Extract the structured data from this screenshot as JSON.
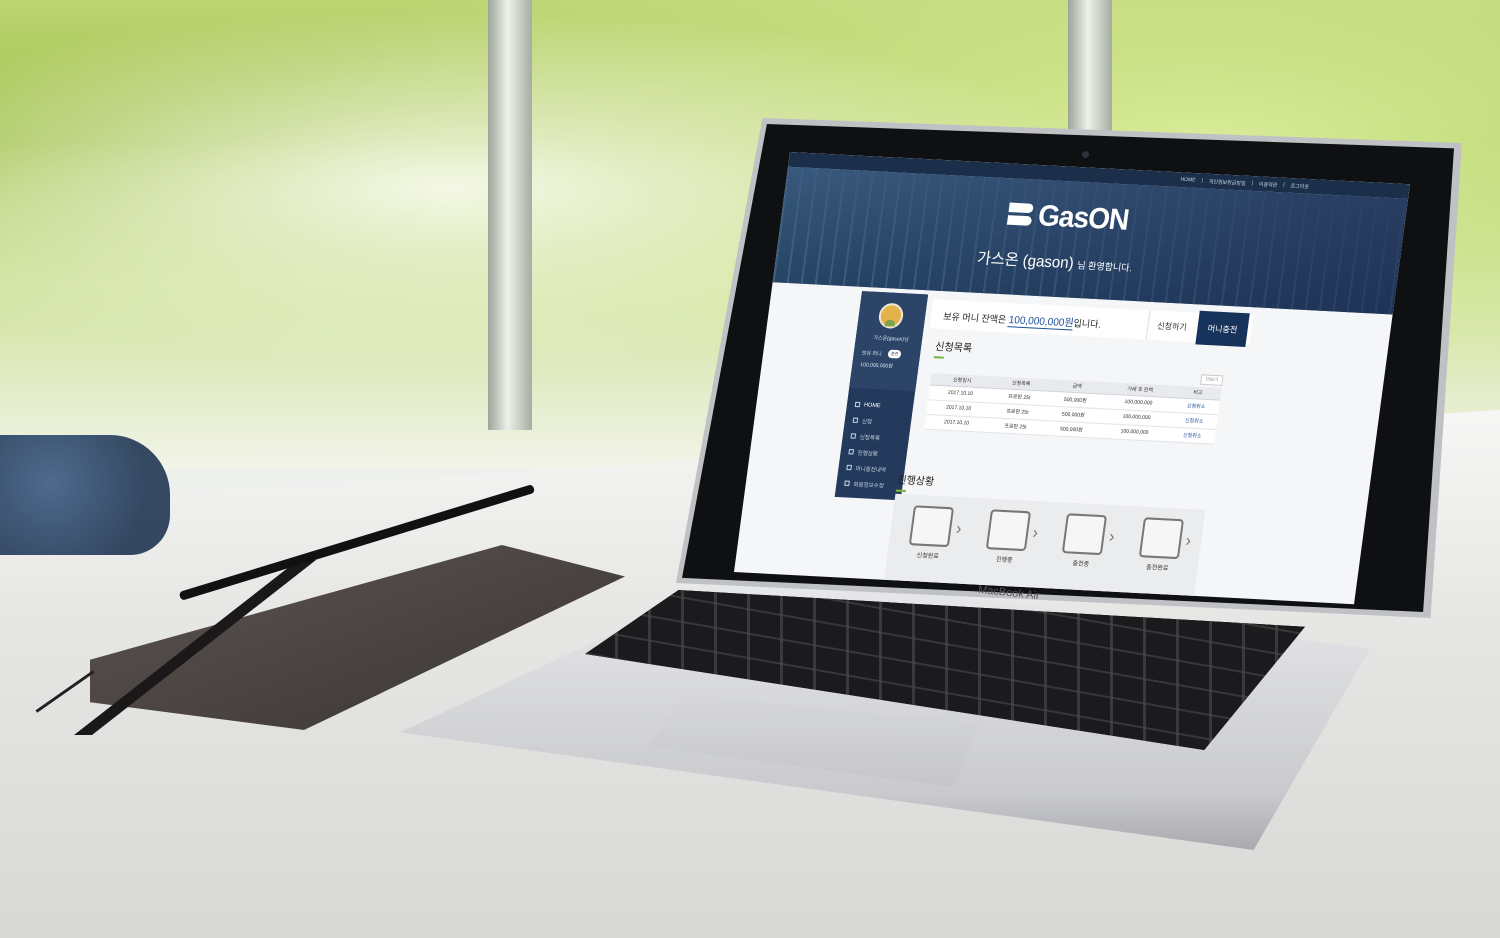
{
  "topbar": {
    "links": [
      "HOME",
      "|",
      "개인정보취급방침",
      "|",
      "이용약관",
      "|",
      "로그아웃"
    ]
  },
  "hero": {
    "logo": "GasON",
    "welcome_name": "가스온 (gason)",
    "welcome_suffix": "님 환영합니다."
  },
  "balance": {
    "prefix": "보유 머니 잔액은 ",
    "amount": "100,000,000원",
    "suffix": "입니다.",
    "apply_button": "신청하기",
    "charge_button": "머니충전"
  },
  "sidebar": {
    "user_name": "가스온(gason)님",
    "money_label": "보유 머니",
    "money_badge": "충전",
    "money_value": "100,000,000원",
    "items": [
      {
        "label": "HOME",
        "icon": "home-icon"
      },
      {
        "label": "신청",
        "icon": "pencil-icon"
      },
      {
        "label": "신청목록",
        "icon": "document-icon"
      },
      {
        "label": "진행상황",
        "icon": "truck-icon"
      },
      {
        "label": "머니충전내역",
        "icon": "wallet-icon"
      },
      {
        "label": "회원정보수정",
        "icon": "user-icon"
      }
    ]
  },
  "apply_list": {
    "title": "신청목록",
    "more": "더보기",
    "headers": [
      "신청일시",
      "신청목록",
      "금액",
      "거래 후 잔액",
      "비고"
    ],
    "rows": [
      [
        "2017.10.10",
        "프로판 25t",
        "500,000원",
        "100,000,000",
        "신청취소"
      ],
      [
        "2017.10.10",
        "프로판 25t",
        "500,000원",
        "100,000,000",
        "신청취소"
      ],
      [
        "2017.10.10",
        "프로판 25t",
        "500,000원",
        "100,000,000",
        "신청취소"
      ]
    ]
  },
  "progress": {
    "title": "진행상황",
    "steps": [
      {
        "label": "신청완료",
        "icon": "application-icon"
      },
      {
        "label": "진행중",
        "icon": "gas-tank-icon"
      },
      {
        "label": "충전중",
        "icon": "charging-truck-icon"
      },
      {
        "label": "충전완료",
        "icon": "building-icon"
      }
    ]
  },
  "device": {
    "laptop_label": "MacBook Air"
  }
}
